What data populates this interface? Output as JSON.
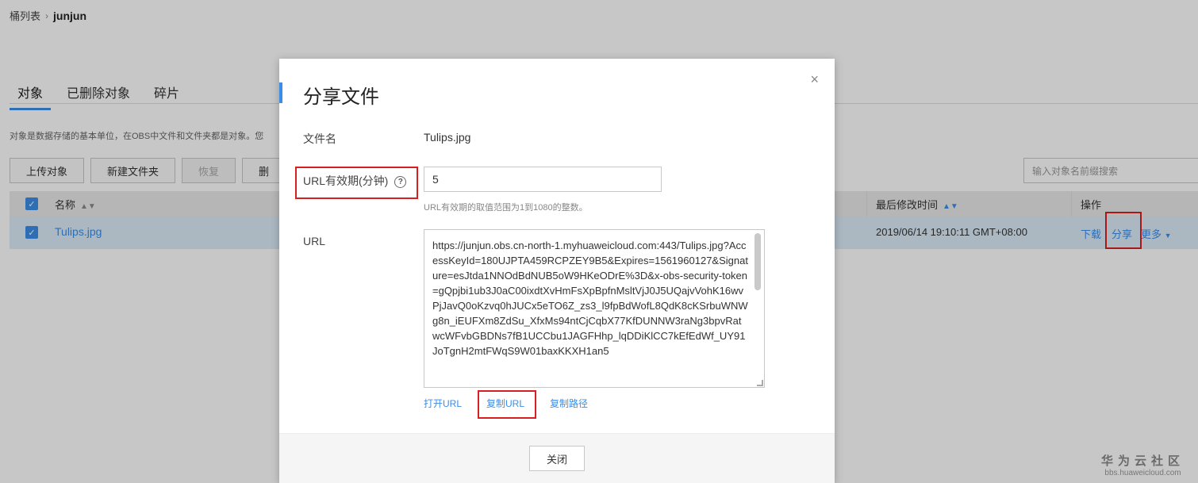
{
  "breadcrumb": {
    "root": "桶列表",
    "separator": "›",
    "current": "junjun"
  },
  "tabs": [
    "对象",
    "已删除对象",
    "碎片"
  ],
  "description": "对象是数据存储的基本单位，在OBS中文件和文件夹都是对象。您",
  "toolbar": {
    "upload": "上传对象",
    "new_folder": "新建文件夹",
    "restore": "恢复",
    "delete_partial": "删"
  },
  "search": {
    "placeholder": "输入对象名前缀搜索"
  },
  "table": {
    "col_name": "名称",
    "col_modified": "最后修改时间",
    "col_actions": "操作",
    "row": {
      "name": "Tulips.jpg",
      "modified": "2019/06/14 19:10:11 GMT+08:00",
      "download": "下载",
      "share": "分享",
      "more": "更多"
    }
  },
  "modal": {
    "title": "分享文件",
    "close_icon": "×",
    "filename_label": "文件名",
    "filename_value": "Tulips.jpg",
    "url_validity_label": "URL有效期(分钟)",
    "url_validity_value": "5",
    "url_validity_hint": "URL有效期的取值范围为1到1080的整数。",
    "url_label": "URL",
    "url_value": "https://junjun.obs.cn-north-1.myhuaweicloud.com:443/Tulips.jpg?AccessKeyId=180UJPTA459RCPZEY9B5&Expires=1561960127&Signature=esJtda1NNOdBdNUB5oW9HKeODrE%3D&x-obs-security-token=gQpjbi1ub3J0aC00ixdtXvHmFsXpBpfnMsltVjJ0J5UQajvVohK16wvPjJavQ0oKzvq0hJUCx5eTO6Z_zs3_l9fpBdWofL8QdK8cKSrbuWNWg8n_iEUFXm8ZdSu_XfxMs94ntCjCqbX77KfDUNNW3raNg3bpvRatwcWFvbGBDNs7fB1UCCbu1JAGFHhp_lqDDiKlCC7kEfEdWf_UY91JoTgnH2mtFWqS9W01baxKKXH1an5",
    "open_url": "打开URL",
    "copy_url": "复制URL",
    "copy_path": "复制路径",
    "close_button": "关闭"
  },
  "watermark": {
    "big": "华为云社区",
    "small": "bbs.huaweicloud.com"
  },
  "colors": {
    "accent": "#3b8ee8",
    "highlight_box": "#d62020",
    "row_selected": "#dbecf9"
  }
}
